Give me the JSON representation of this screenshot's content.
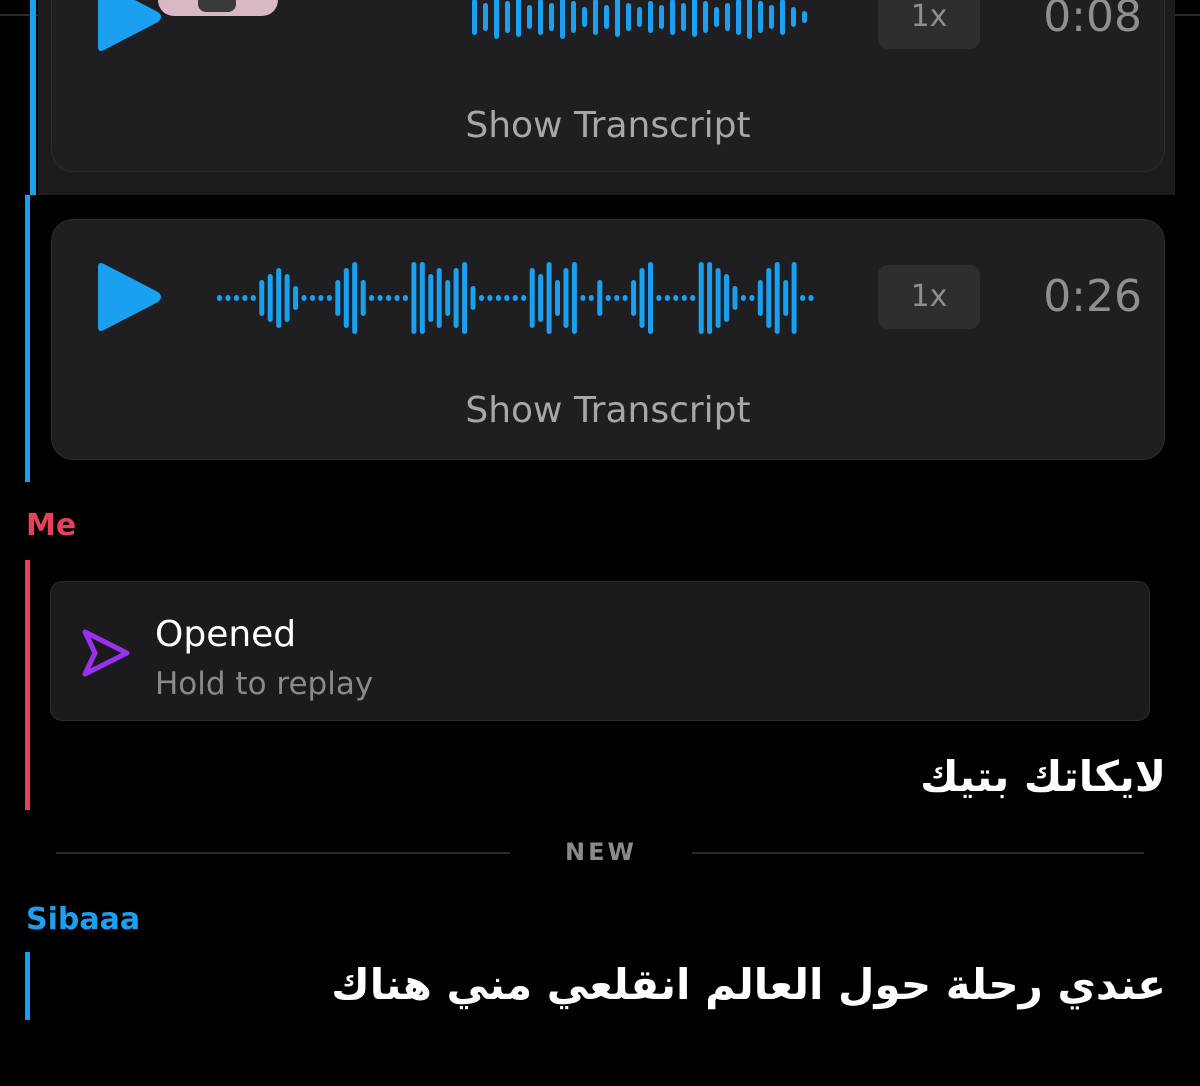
{
  "voice_notes": [
    {
      "speed": "1x",
      "duration": "0:08",
      "transcript_label": "Show Transcript"
    },
    {
      "speed": "1x",
      "duration": "0:26",
      "transcript_label": "Show Transcript"
    }
  ],
  "messages": [
    {
      "sender": "Me",
      "sender_color": "#e8405a",
      "snap": {
        "status": "Opened",
        "hint": "Hold to replay",
        "icon": "sent-arrow-icon",
        "icon_color": "#9b30f0"
      },
      "text": "لايكاتك بتيك"
    },
    {
      "separator": "NEW"
    },
    {
      "sender": "Sibaaa",
      "sender_color": "#19a0f0",
      "text": "عندي رحلة حول العالم انقلعي مني هناك"
    }
  ],
  "colors": {
    "accent_blue": "#19a0f0",
    "me_red": "#e8405a",
    "background": "#000000"
  }
}
